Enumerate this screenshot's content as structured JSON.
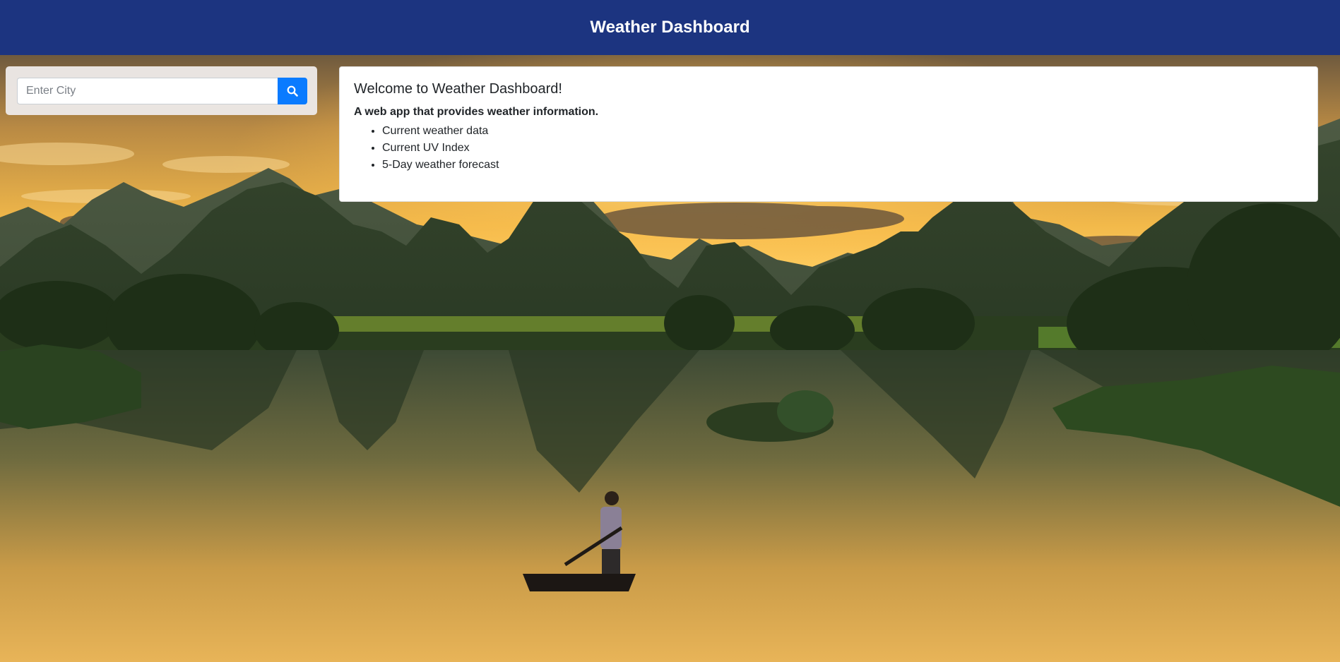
{
  "header": {
    "title": "Weather Dashboard",
    "background_color": "#1c3480"
  },
  "search": {
    "placeholder": "Enter City",
    "value": "",
    "button_icon": "search-icon",
    "button_color": "#0a7bff"
  },
  "welcome": {
    "title": "Welcome to Weather Dashboard!",
    "description": "A web app that provides weather information.",
    "features": [
      "Current weather data",
      "Current UV Index",
      "5-Day weather forecast"
    ]
  },
  "background": {
    "scene": "karst mountains at sunset over a river with a person on a boat"
  }
}
